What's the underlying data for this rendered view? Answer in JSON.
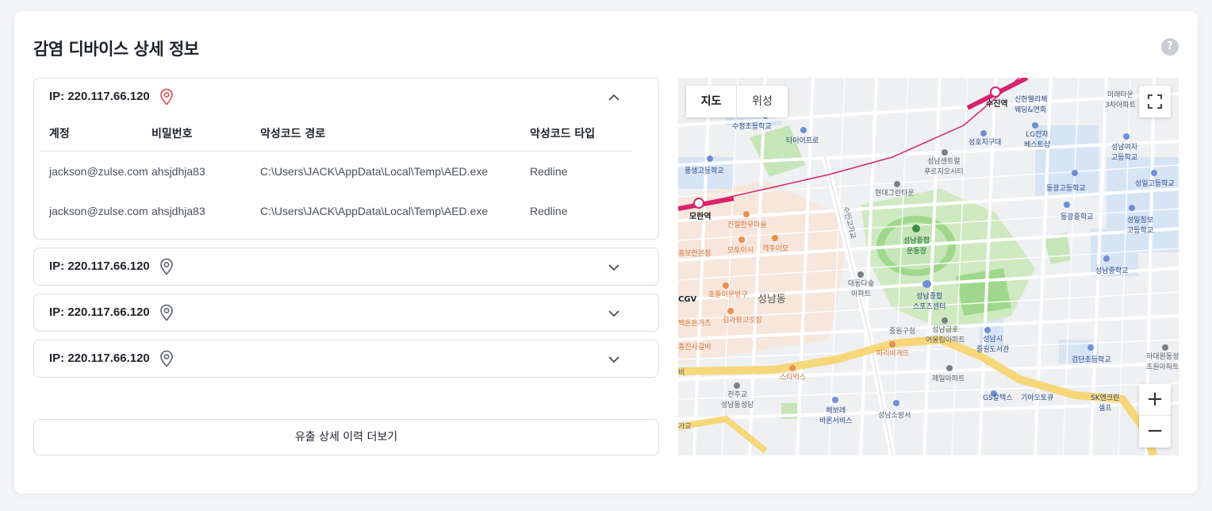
{
  "page": {
    "title": "감염 디바이스 상세 정보",
    "help_label": "?"
  },
  "accordion": {
    "items": [
      {
        "ip": "IP: 220.117.66.120",
        "expanded": true
      },
      {
        "ip": "IP: 220.117.66.120",
        "expanded": false
      },
      {
        "ip": "IP: 220.117.66.120",
        "expanded": false
      },
      {
        "ip": "IP: 220.117.66.120",
        "expanded": false
      }
    ],
    "table": {
      "headers": [
        "계정",
        "비밀번호",
        "악성코드 경로",
        "악성코드 타입"
      ],
      "rows": [
        [
          "jackson@zulse.com",
          "ahsjdhja83",
          "C:\\Users\\JACK\\AppData\\Local\\Temp\\AED.exe",
          "Redline"
        ],
        [
          "jackson@zulse.com",
          "ahsjdhja83",
          "C:\\Users\\JACK\\AppData\\Local\\Temp\\AED.exe",
          "Redline"
        ]
      ]
    }
  },
  "more_button": "유출 상세 이력 더보기",
  "map": {
    "tabs": [
      "지도",
      "위성"
    ],
    "active_tab": "지도",
    "zoom_in": "+",
    "zoom_out": "−",
    "labels": {
      "sujin_station": "수진역",
      "moran_station": "모란역",
      "seongnam_dong": "성남동",
      "stadium": "성남종합\n운동장",
      "sports_center": "성남종합\n스포츠센터",
      "sujeong_school": "수정초등학교",
      "tireprow": "타이어프로",
      "pungsaeng_school": "풍생고등학교",
      "shinhan_wedding": "신한웰리체\n웨딩&연회",
      "mirae_town": "미래타운\n3차아파트",
      "seongho_dist": "성호지구대",
      "lg_best": "LG전자\n베스트샵",
      "seongnam_center": "성남센트럴\n푸르지오시티",
      "hyundai_green": "현대그린타운",
      "seongnam_girls": "성남여자\n고등학교",
      "donggwang_high": "동광고등학교",
      "seongil_high": "성일고등학교",
      "donggwang_middle": "동광중학교",
      "seongil_info": "성일정보\n고등학교",
      "seongnam_middle": "성남중학교",
      "jinjeol": "진절한우마을",
      "moto": "모토이시",
      "gaekju": "객주이모",
      "bonjeom": "흥모란본점",
      "hodol": "호돌이문방구",
      "kimgwa": "김과장고깃집",
      "baekdon": "백돈돈가츠",
      "sajin": "흥진사갈비",
      "daedong": "대동다숲\n아파트",
      "jungwon_office": "중원구청",
      "seongnam_geumho": "성남금호\n어울림아파트",
      "jungwon_library": "성남시\n중원도서관",
      "paris": "파리바게뜨",
      "starbucks": "스타벅스",
      "jeil_apt": "제일아파트",
      "cheonju": "천주교\n성남동성당",
      "bobo": "헤보레\n바론서비스",
      "fire": "성남소방서",
      "gs": "GS칼텍스",
      "kia": "기아오토큐",
      "sk": "SK엔크린\n셀프",
      "geomdan_school": "검단초등학교",
      "hadaewon": "하대원동성\n초원아파트",
      "road_suin": "수인고가교",
      "gyo": "가교",
      "cgv": "CGV",
      "bi": "비"
    }
  },
  "colors": {
    "accent_pin_active": "#e5484d",
    "pin_inactive": "#5f646b",
    "metro_line": "#d6246e",
    "main_road": "#f6d77a",
    "park": "#bfe3b0"
  }
}
